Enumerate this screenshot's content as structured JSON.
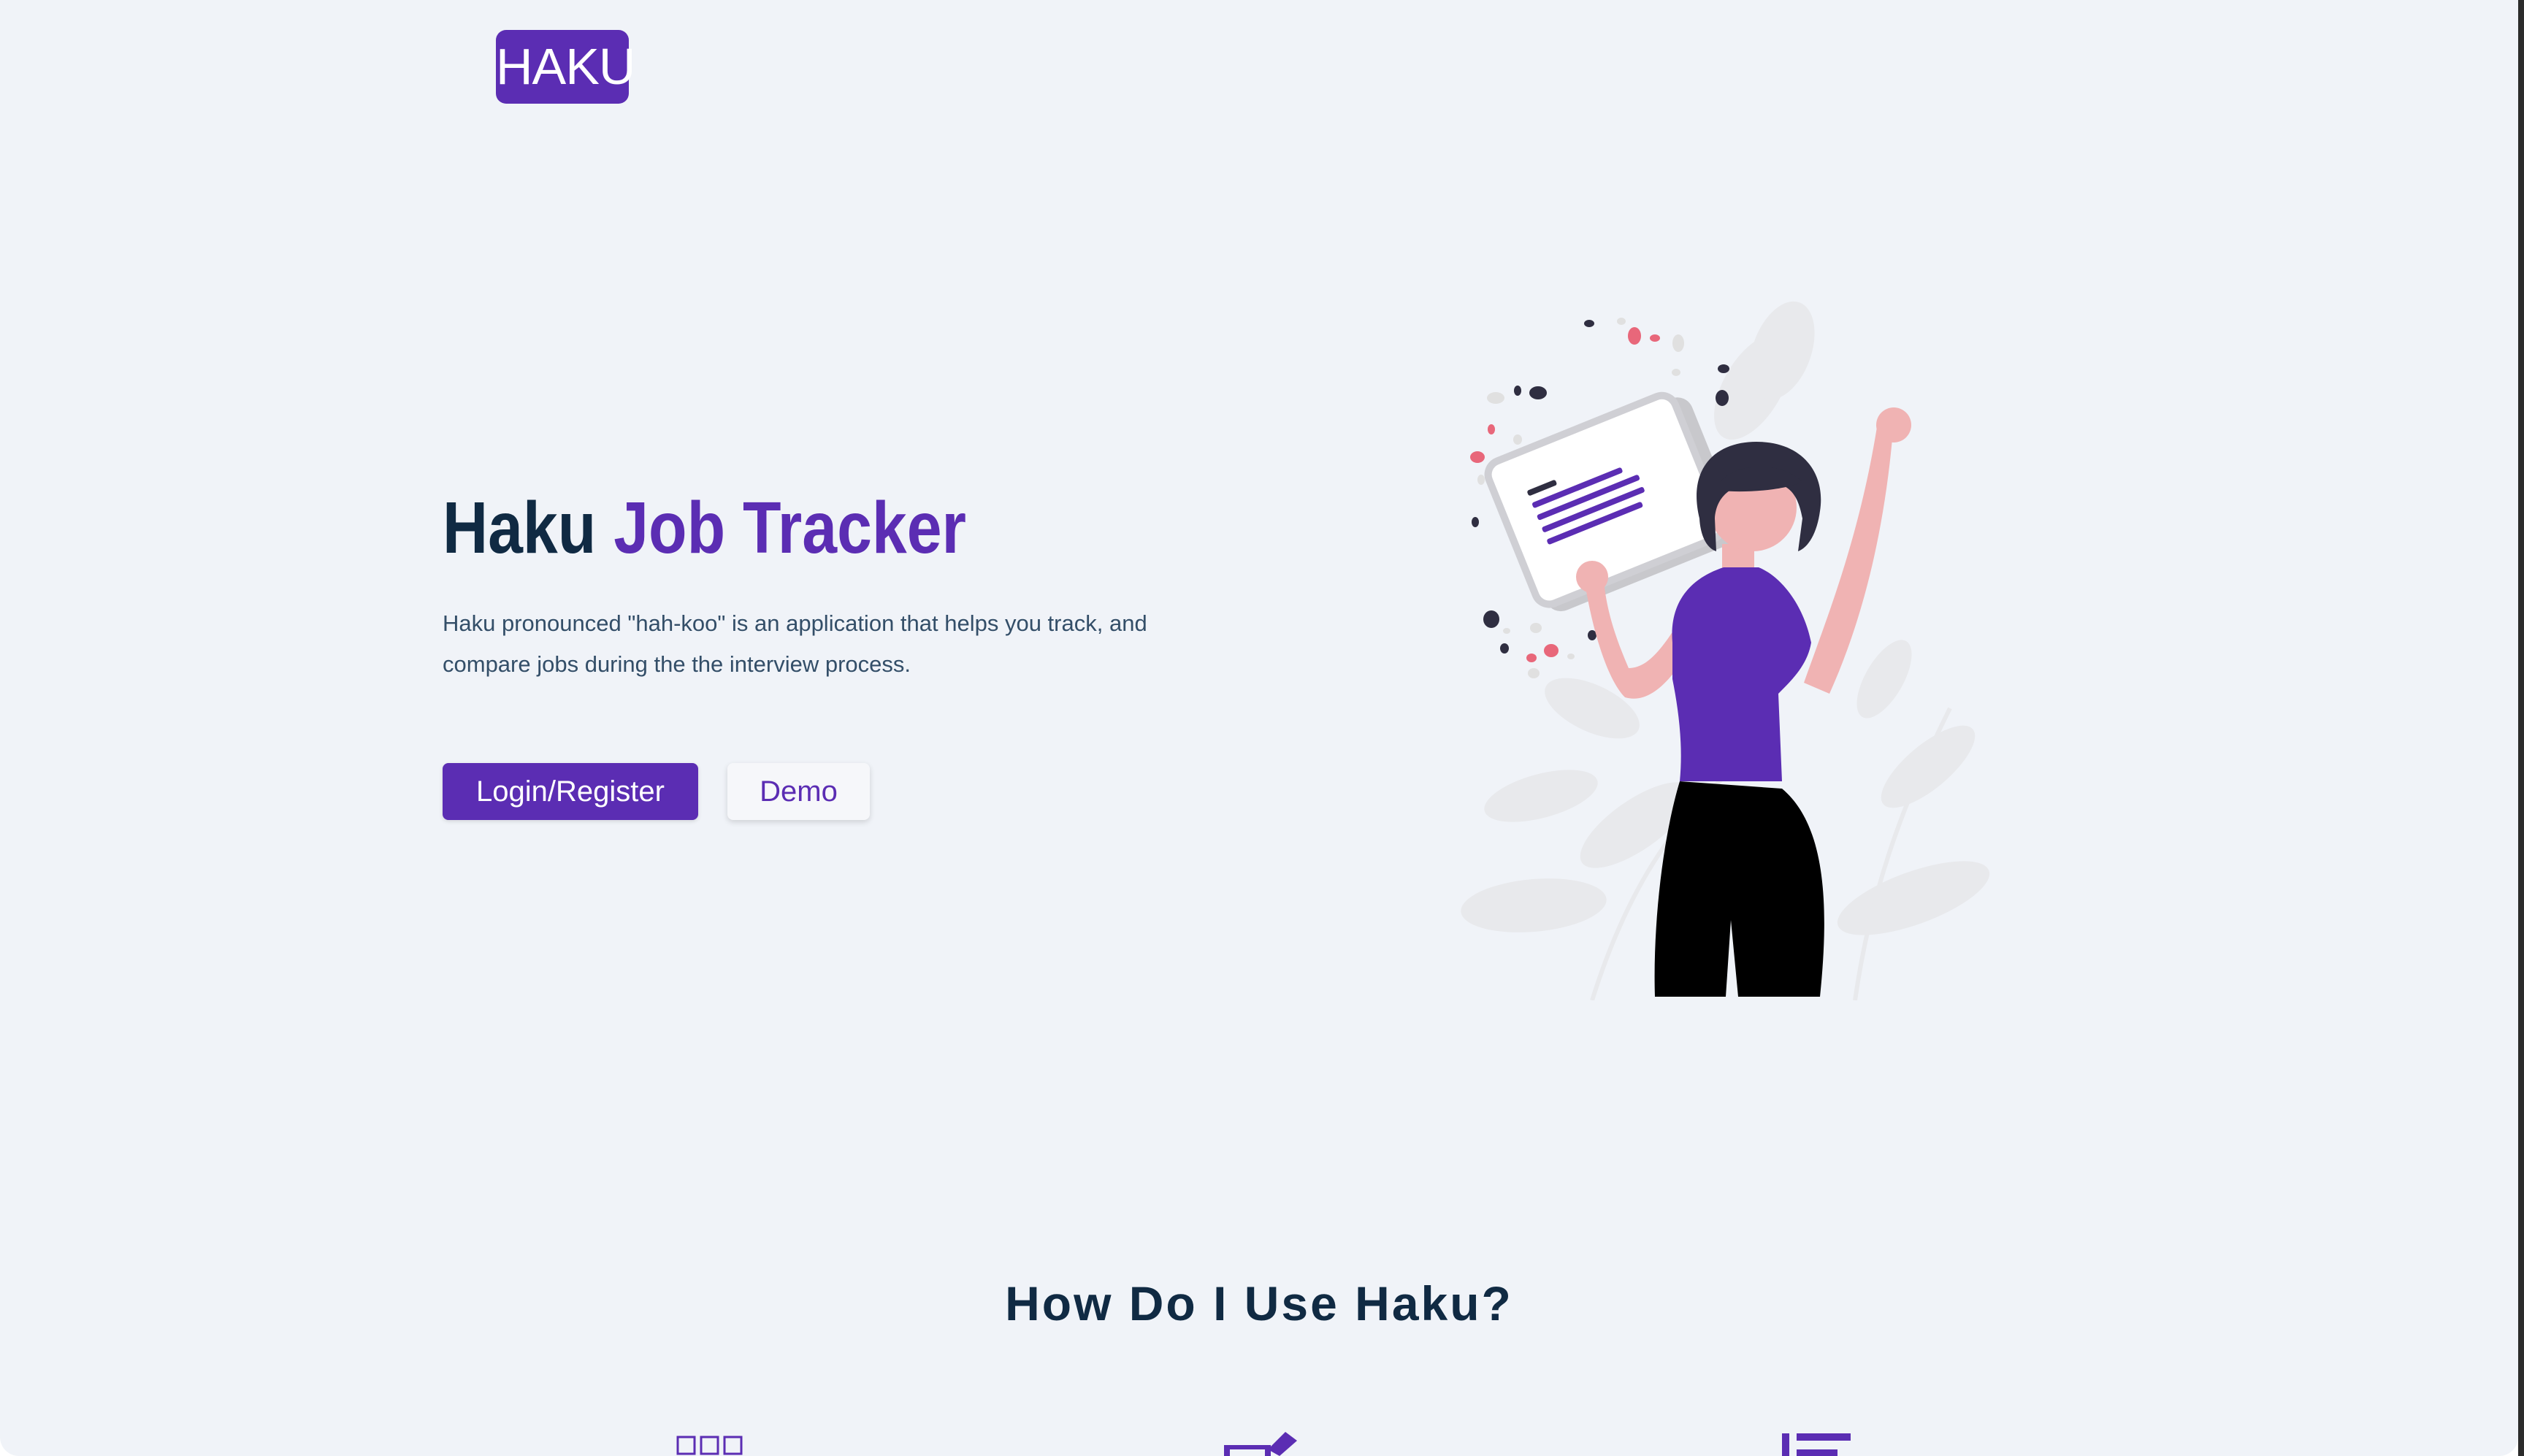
{
  "brand": {
    "logo_text": "HAKU",
    "primary_color": "#5b2db3",
    "dark_text_color": "#102a43",
    "background_color": "#f0f3f8"
  },
  "hero": {
    "title_main": "Haku ",
    "title_accent": "Job Tracker",
    "description": "Haku pronounced \"hah-koo\" is an application that helps you track, and compare jobs during the the interview process.",
    "login_button": "Login/Register",
    "demo_button": "Demo",
    "illustration": "woman-holding-document-illustration"
  },
  "how_to": {
    "title": "How Do I Use Haku?",
    "icons": [
      "grid-icon",
      "edit-icon",
      "list-icon"
    ]
  }
}
